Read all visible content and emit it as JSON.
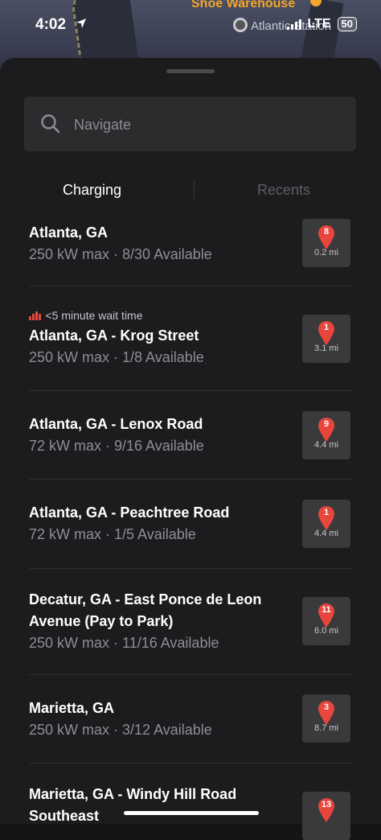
{
  "status_bar": {
    "time": "4:02",
    "network": "LTE",
    "battery": "50"
  },
  "map": {
    "poi_label": "Shoe Warehouse",
    "station_label": "Atlantic Station"
  },
  "search": {
    "placeholder": "Navigate"
  },
  "tabs": [
    {
      "label": "Charging",
      "active": true
    },
    {
      "label": "Recents",
      "active": false
    }
  ],
  "stations": [
    {
      "name": "Atlanta, GA",
      "detail": "250 kW max · 8/30 Available",
      "count": "8",
      "distance": "0.2 mi"
    },
    {
      "wait": "<5 minute wait time",
      "name": "Atlanta, GA - Krog Street",
      "detail": "250 kW max · 1/8 Available",
      "count": "1",
      "distance": "3.1 mi"
    },
    {
      "name": "Atlanta, GA - Lenox Road",
      "detail": "72 kW max · 9/16 Available",
      "count": "9",
      "distance": "4.4 mi"
    },
    {
      "name": "Atlanta, GA - Peachtree Road",
      "detail": "72 kW max · 1/5 Available",
      "count": "1",
      "distance": "4.4 mi"
    },
    {
      "name": "Decatur, GA - East Ponce de Leon Avenue (Pay to Park)",
      "detail": "250 kW max · 11/16 Available",
      "count": "11",
      "distance": "6.0 mi"
    },
    {
      "name": "Marietta, GA",
      "detail": "250 kW max · 3/12 Available",
      "count": "3",
      "distance": "8.7 mi"
    },
    {
      "name": "Marietta, GA - Windy Hill Road Southeast",
      "detail": "",
      "count": "13",
      "distance": ""
    }
  ],
  "colors": {
    "pin": "#e8453c",
    "background": "#1c1c1e"
  }
}
